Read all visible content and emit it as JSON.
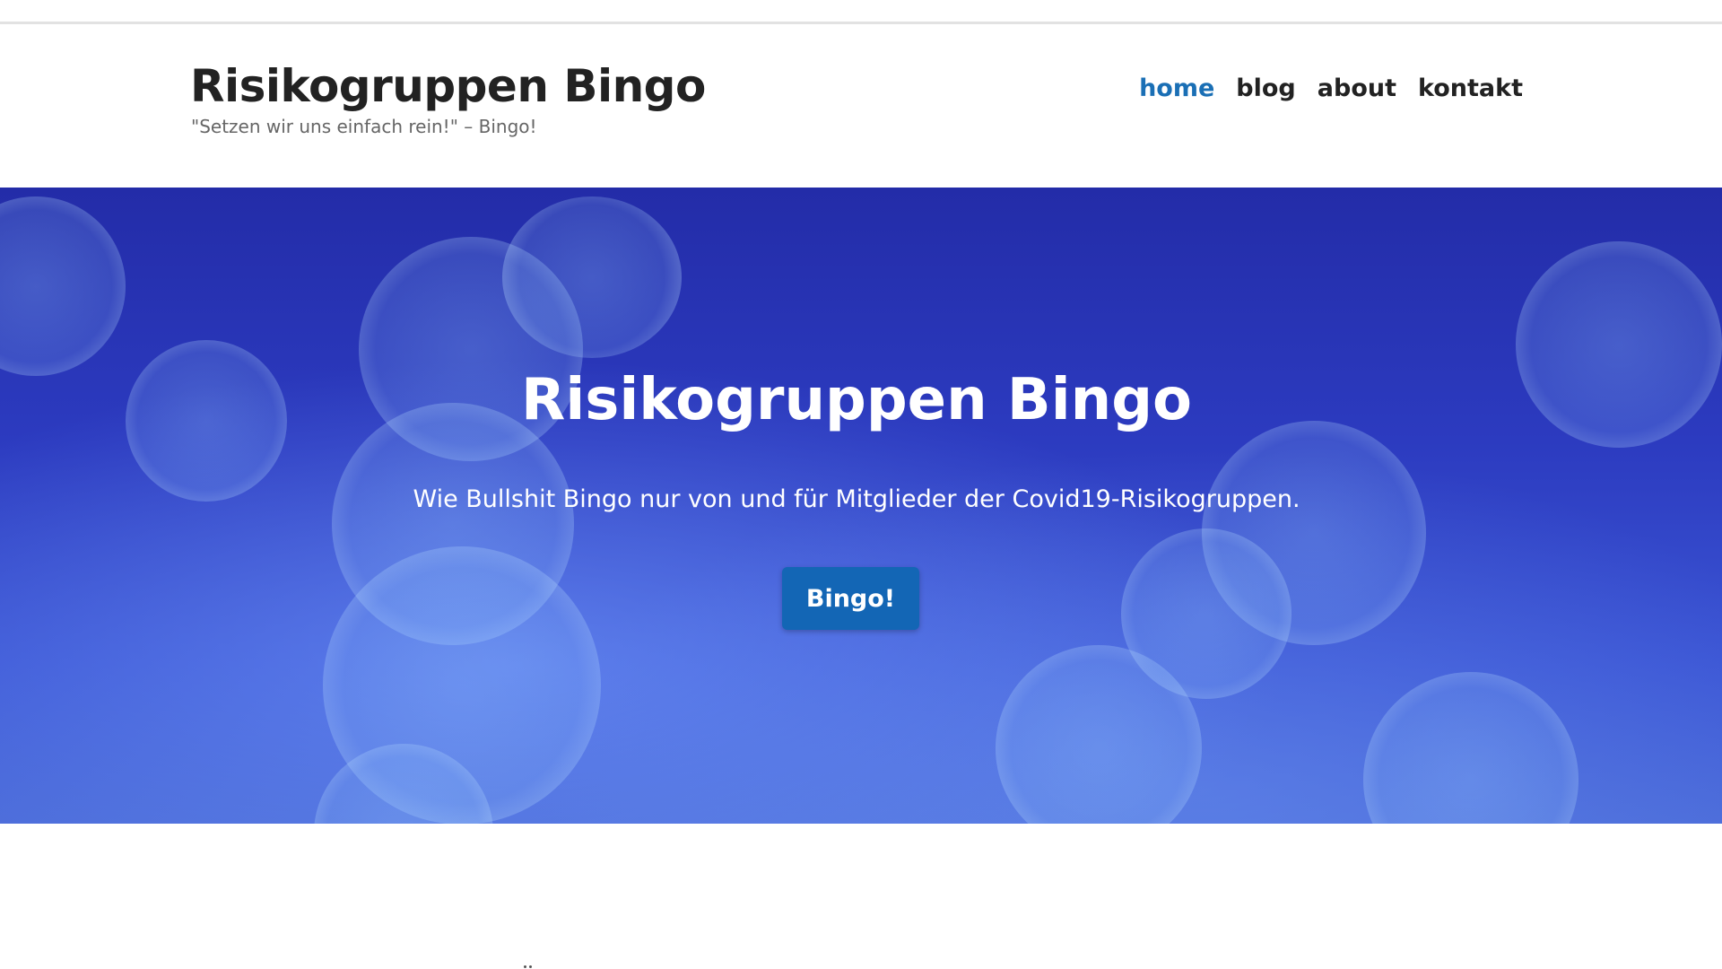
{
  "site": {
    "title": "Risikogruppen Bingo",
    "tagline": "\"Setzen wir uns einfach rein!\" – Bingo!"
  },
  "nav": {
    "items": [
      {
        "label": "home",
        "active": true
      },
      {
        "label": "blog",
        "active": false
      },
      {
        "label": "about",
        "active": false
      },
      {
        "label": "kontakt",
        "active": false
      }
    ]
  },
  "hero": {
    "title": "Risikogruppen Bingo",
    "subtitle": "Wie Bullshit Bingo nur von und für Mitglieder der Covid19-Risikogruppen.",
    "button_label": "Bingo!"
  },
  "colors": {
    "accent": "#1a6fb5",
    "button": "#1366b5",
    "hero_background": "#2c3bc0",
    "text_dark": "#222222",
    "text_muted": "#666666"
  }
}
